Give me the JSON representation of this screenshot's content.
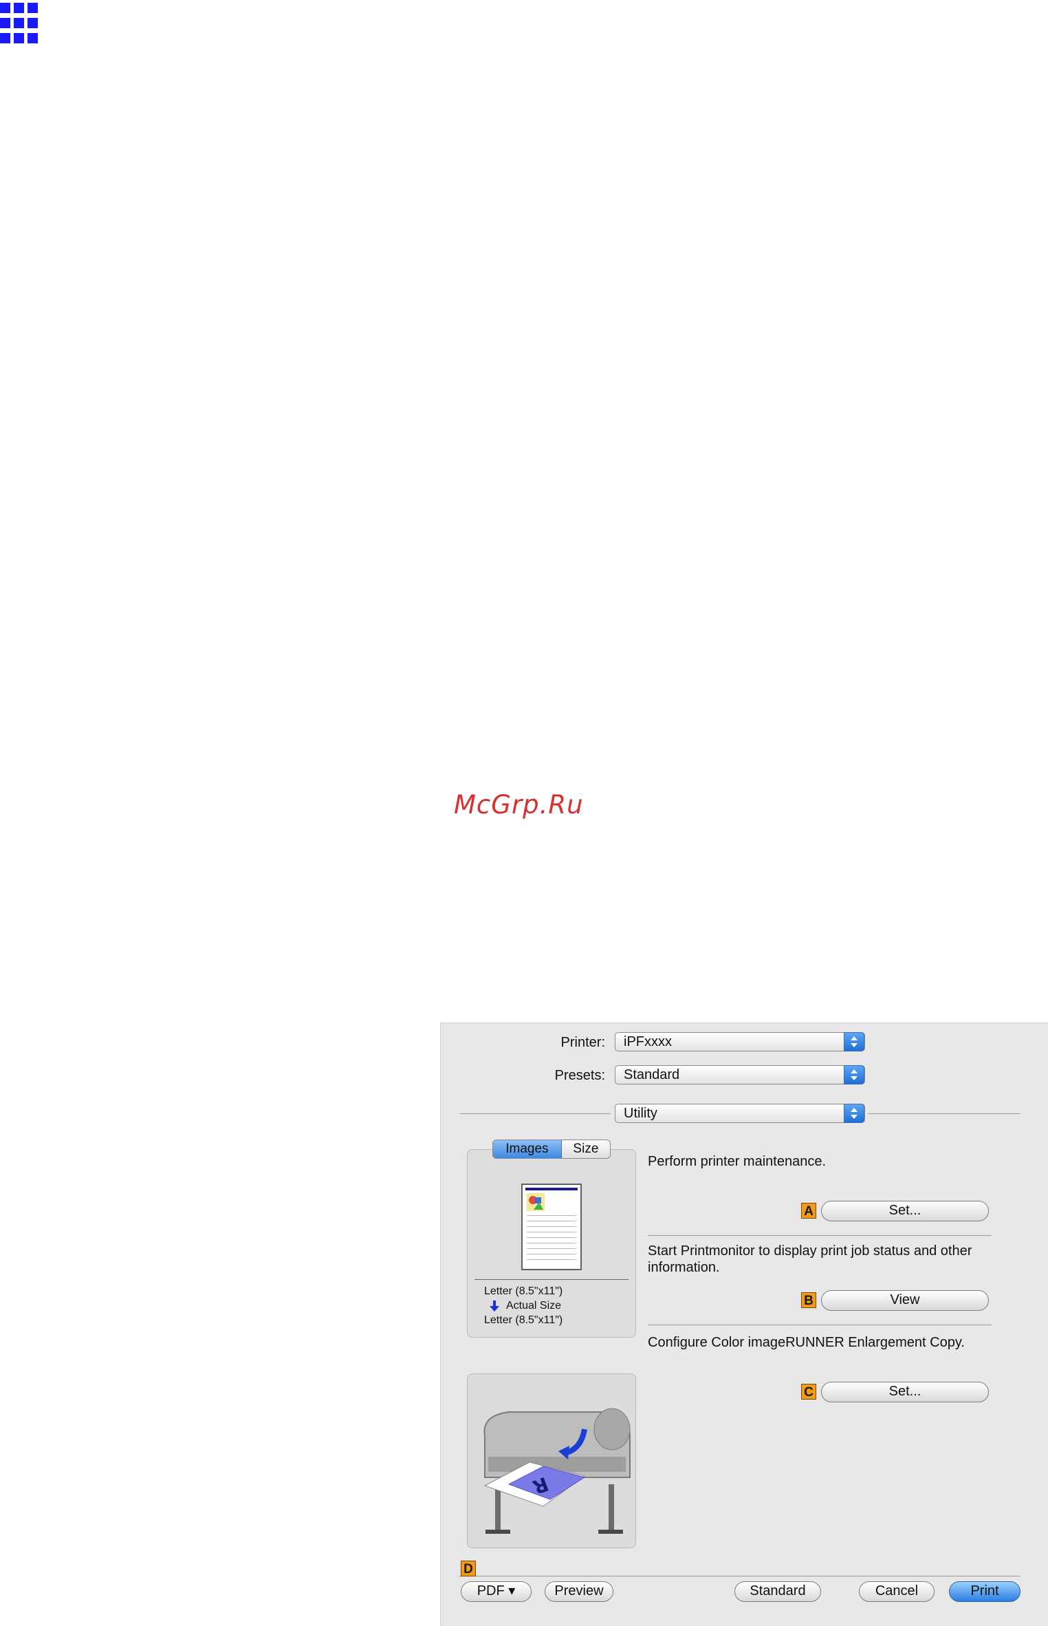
{
  "watermark": "McGrp.Ru",
  "dialog": {
    "printer_label": "Printer:",
    "printer_value": "iPFxxxx",
    "presets_label": "Presets:",
    "presets_value": "Standard",
    "pane_value": "Utility",
    "preview_tabs": [
      "Images",
      "Size"
    ],
    "preview_info": {
      "input_size": "Letter (8.5\"x11\")",
      "scale": "Actual Size",
      "output_size": "Letter (8.5\"x11\")"
    },
    "actions": [
      {
        "badge": "A",
        "description": "Perform printer maintenance.",
        "button": "Set..."
      },
      {
        "badge": "B",
        "description": "Start Printmonitor to display print job status and other information.",
        "button": "View"
      },
      {
        "badge": "C",
        "description": "Configure Color imageRUNNER Enlargement Copy.",
        "button": "Set..."
      }
    ],
    "bottom_badge": "D",
    "bottom_buttons": {
      "pdf": "PDF ▾",
      "preview": "Preview",
      "standard": "Standard",
      "cancel": "Cancel",
      "print": "Print"
    }
  },
  "colors": {
    "logo_blue": "#1a1aff",
    "watermark_red": "#d73030",
    "badge_orange": "#f39a1a",
    "accent_blue": "#2a7ee0"
  }
}
